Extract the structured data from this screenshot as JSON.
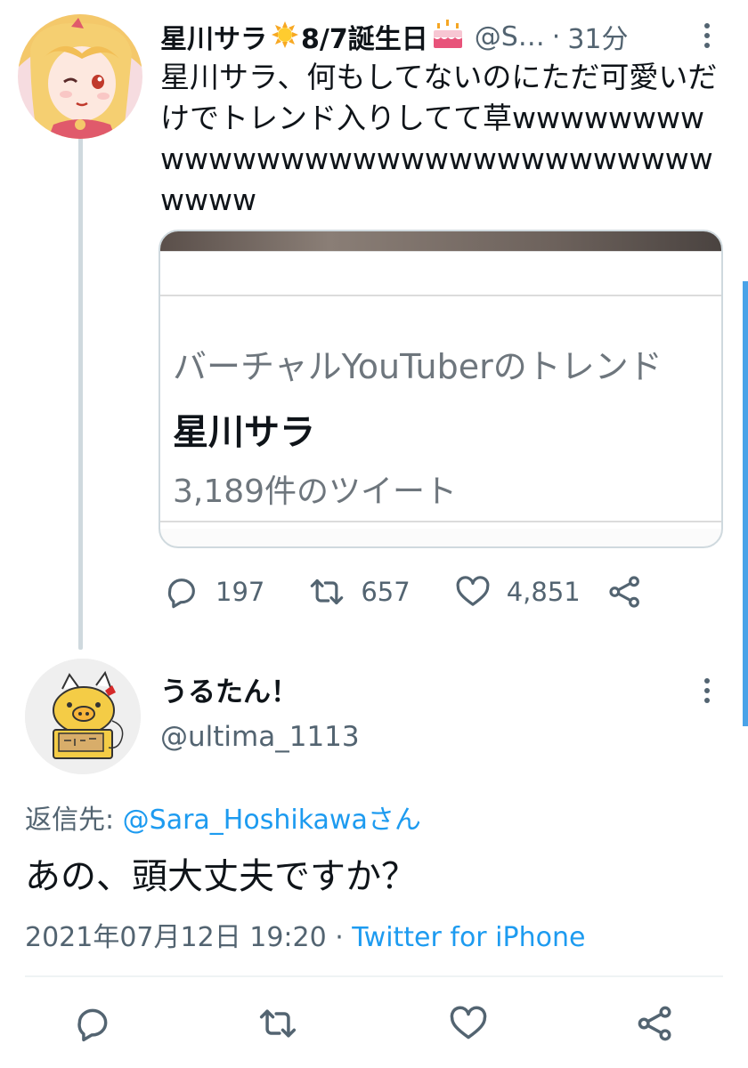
{
  "tweet": {
    "author_name": "星川サラ",
    "birthday_text": "8/7誕生日",
    "handle": "@S…",
    "separator": "·",
    "time": "31分",
    "text": "星川サラ、何もしてないのにただ可愛いだけでトレンド入りしてて草wwwwwwwwwwwwwwwwwwwwwwwwwwwwwwwwwww",
    "card": {
      "label": "バーチャルYouTuberのトレンド",
      "title": "星川サラ",
      "count": "3,189件のツイート"
    },
    "actions": {
      "replies": "197",
      "retweets": "657",
      "likes": "4,851"
    }
  },
  "reply": {
    "author_name": "うるたん！",
    "handle": "@ultima_1113",
    "reply_to_prefix": "返信先: ",
    "reply_to_mention": "@Sara_Hoshikawa",
    "reply_to_suffix": "さん",
    "text": "あの、頭大丈夫ですか？",
    "timestamp": "2021年07月12日 19:20",
    "meta_separator": " · ",
    "source": "Twitter for iPhone"
  },
  "icons": {
    "reply": "comment-icon",
    "retweet": "retweet-icon",
    "like": "heart-icon",
    "share": "share-icon",
    "more": "kebab-icon",
    "sun": "sun-emoji",
    "cake": "cake-emoji"
  },
  "colors": {
    "link": "#1d9bf0",
    "secondary_text": "#536471",
    "thread_line": "#cfd9de",
    "scroll_indicator": "#4aa3e8"
  }
}
